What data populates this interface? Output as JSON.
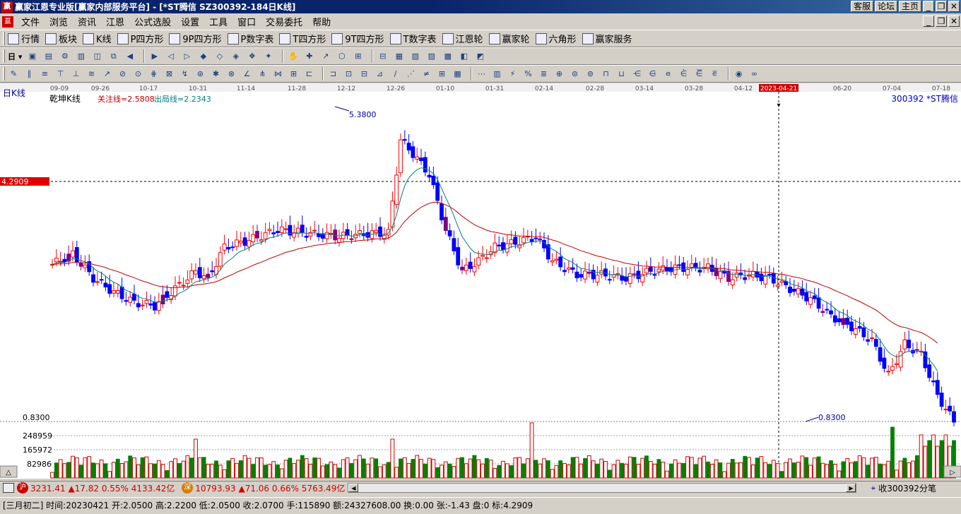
{
  "window": {
    "title": "赢家江恩专业版[赢家内部服务平台] - [*ST腾信   SZ300392-184日K线]",
    "logo_text": "赢",
    "buttons": [
      "客服",
      "论坛",
      "主页"
    ]
  },
  "menu": {
    "items": [
      "文件",
      "浏览",
      "资讯",
      "江恩",
      "公式选股",
      "设置",
      "工具",
      "窗口",
      "交易委托",
      "帮助"
    ]
  },
  "toolbar1": {
    "items": [
      {
        "label": "行情",
        "icon": "grid-icon"
      },
      {
        "label": "板块",
        "icon": "sector-icon"
      },
      {
        "label": "K线",
        "icon": "kline-icon"
      },
      {
        "label": "P四方形",
        "icon": "ps-icon"
      },
      {
        "label": "9P四方形",
        "icon": "p9-icon"
      },
      {
        "label": "P数字表",
        "icon": "pn-icon"
      },
      {
        "label": "T四方形",
        "icon": "ts-icon"
      },
      {
        "label": "9T四方形",
        "icon": "t9-icon"
      },
      {
        "label": "T数字表",
        "icon": "tn-icon"
      },
      {
        "label": "江恩轮",
        "icon": "gann-wheel-icon"
      },
      {
        "label": "赢家轮",
        "icon": "winner-wheel-icon"
      },
      {
        "label": "六角形",
        "icon": "hexagon-icon"
      },
      {
        "label": "赢家服务",
        "icon": "dollar-icon"
      }
    ]
  },
  "chart": {
    "period_label": "日K线",
    "indicator_name": "乾坤K线",
    "focus_line": "关注线=2.5808",
    "exit_line": "出局线=2.2343",
    "stock_label": "300392 *ST腾信",
    "price_marker": "4.2909",
    "high_label": "5.3800",
    "low_label": "0.8300",
    "low_axis_label": "0.8300",
    "volume_axis": [
      "248959",
      "165972",
      "82986"
    ],
    "date_ticks": [
      "09-09",
      "09-26",
      "10-17",
      "10-31",
      "11-14",
      "11-28",
      "12-12",
      "12-26",
      "01-10",
      "01-31",
      "02-14",
      "02-28",
      "03-14",
      "03-28",
      "04-12",
      "2023-04-21",
      "06-20",
      "07-04",
      "07-18"
    ],
    "cursor_date": "2023-04-21"
  },
  "chart_data": {
    "type": "candlestick",
    "title": "300392 *ST腾信",
    "series": [
      {
        "name": "乾坤K线"
      },
      {
        "name": "关注线"
      },
      {
        "name": "出局线"
      }
    ],
    "ylim": [
      0.83,
      5.38
    ],
    "last_values": {
      "关注线": 2.5808,
      "出局线": 2.2343
    }
  },
  "status": {
    "sh_badge": "沪",
    "sh_text": "3231.41 ▲17.82 0.55% 4133.42亿",
    "sz_badge": "深",
    "sz_text": "10793.93 ▲71.06 0.66% 5763.49亿",
    "right_text": "收300392分笔"
  },
  "infobar": {
    "text": "[三月初二] 时间:20230421 开:2.0500 高:2.2200 低:2.0500 收:2.0700 手:115890 额:24327608.00 换:0.00 张:-1.43 盘:0 标:4.2909"
  }
}
